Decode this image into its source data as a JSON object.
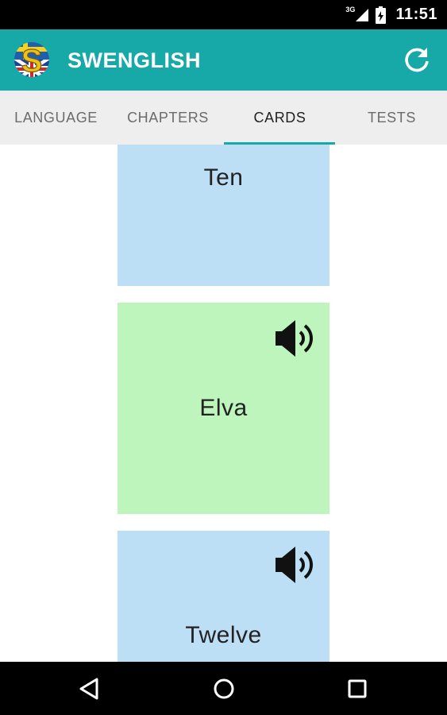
{
  "status_bar": {
    "network": "3G",
    "time": "11:51"
  },
  "app_bar": {
    "title": "SWENGLISH",
    "logo_letter": "S",
    "refresh_icon": "refresh-icon",
    "colors": {
      "primary": "#17a8a8",
      "text": "#ffffff"
    }
  },
  "tabs": [
    {
      "label": "LANGUAGE",
      "active": false
    },
    {
      "label": "CHAPTERS",
      "active": false
    },
    {
      "label": "CARDS",
      "active": true
    },
    {
      "label": "TESTS",
      "active": false
    }
  ],
  "cards": [
    {
      "word": "Ten",
      "color": "#bcdff6",
      "speaker": false
    },
    {
      "word": "Elva",
      "color": "#bdf5bd",
      "speaker": true
    },
    {
      "word": "Twelve",
      "color": "#bcdff6",
      "speaker": true
    }
  ],
  "nav_bar": {
    "icons": [
      "back-icon",
      "home-icon",
      "recents-icon"
    ]
  }
}
